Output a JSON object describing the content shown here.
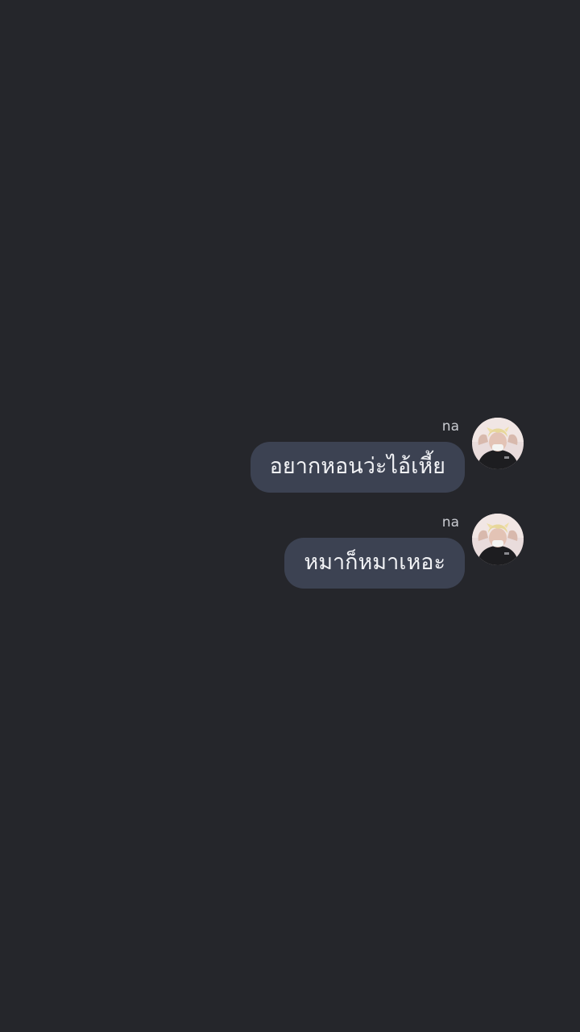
{
  "chat": {
    "messages": [
      {
        "sender": "na",
        "text": "อยากหอนว่ะไอ้เหี้ย",
        "avatar_icon": "user-avatar-photo"
      },
      {
        "sender": "na",
        "text": "หมาก็หมาเหอะ",
        "avatar_icon": "user-avatar-photo"
      }
    ]
  },
  "colors": {
    "background": "#25262b",
    "bubble": "#3c4252",
    "bubble_text": "#f1f2f5",
    "sender_text": "#c9cbd1"
  }
}
